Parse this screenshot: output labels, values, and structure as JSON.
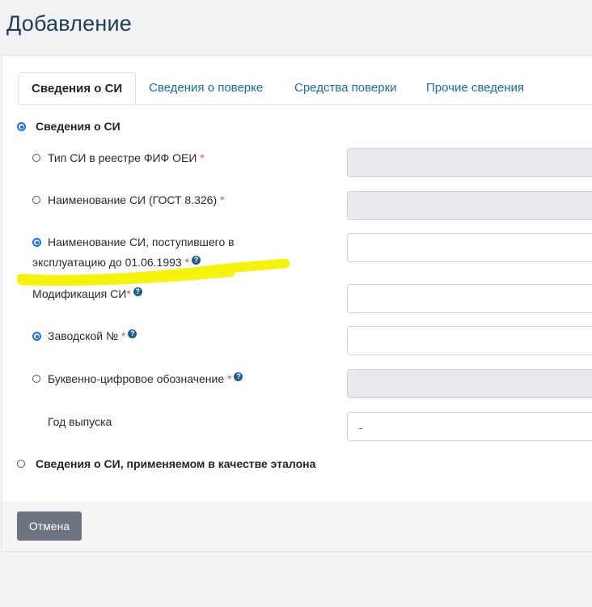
{
  "page": {
    "title": "Добавление"
  },
  "tabs": [
    {
      "label": "Сведения о СИ"
    },
    {
      "label": "Сведения о поверке"
    },
    {
      "label": "Средства поверки"
    },
    {
      "label": "Прочие сведения"
    }
  ],
  "sections": {
    "si_info": "Сведения о СИ",
    "etalon_info": "Сведения о СИ, применяемом в качестве эталона"
  },
  "fields": {
    "type_registry": {
      "label": "Тип СИ в реестре ФИФ ОЕИ",
      "required": "*",
      "value": ""
    },
    "name_gost": {
      "label": "Наименование СИ (ГОСТ 8.326)",
      "required": "*",
      "value": ""
    },
    "name_before_1993_line1": {
      "label": "Наименование СИ, поступившего в"
    },
    "name_before_1993_line2": {
      "label": "эксплуатацию до 01.06.1993",
      "required": "*",
      "value": ""
    },
    "modification": {
      "label": "Модификация СИ",
      "required": "*",
      "value": ""
    },
    "serial_number": {
      "label": "Заводской №",
      "required": "*",
      "value": ""
    },
    "alphanumeric": {
      "label": "Буквенно-цифровое обозначение",
      "required": "*",
      "value": ""
    },
    "year": {
      "label": "Год выпуска",
      "value": "-"
    }
  },
  "help_glyph": "?",
  "footer": {
    "cancel_label": "Отмена"
  },
  "colors": {
    "accent": "#1c6ef2",
    "link": "#1b6ca8",
    "title": "#1f3d56",
    "highlight": "#f6f20a",
    "button": "#6c757d"
  }
}
